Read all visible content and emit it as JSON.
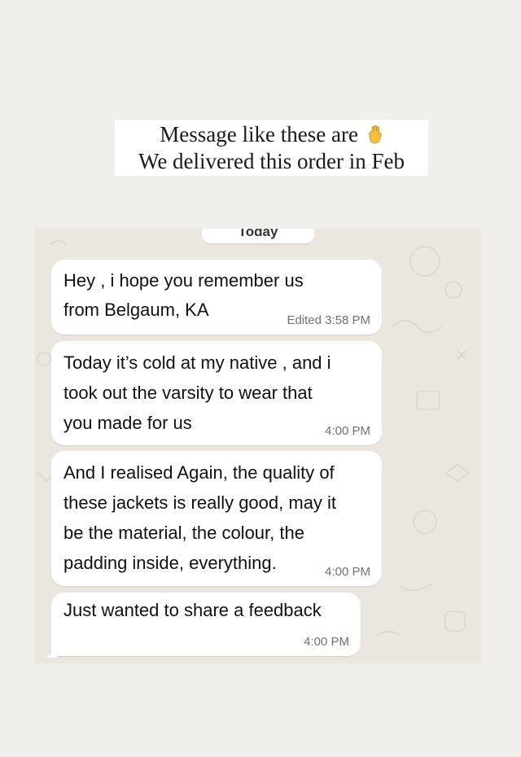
{
  "caption": {
    "line1": "Message like these are",
    "line2": "We delivered this order in Feb",
    "emoji_icon": "hand-emoji-icon"
  },
  "chat": {
    "date_divider": "Today",
    "messages": [
      {
        "text": "Hey      , i hope you remember us\nfrom Belgaum, KA",
        "meta": "Edited 3:58 PM"
      },
      {
        "text": "Today it’s cold at my native , and i\ntook out the varsity to wear that\nyou made for us",
        "meta": "4:00 PM"
      },
      {
        "text": "And I realised Again, the quality of\nthese jackets is really good, may it\nbe the material, the colour, the\npadding inside, everything.",
        "meta": "4:00 PM"
      },
      {
        "text": "Just wanted to share a feedback",
        "meta": "4:00 PM"
      }
    ]
  },
  "colors": {
    "page_background": "#f1efec",
    "chat_background": "#ebe6df",
    "bubble_background": "#ffffff",
    "timestamp_text": "#707070"
  }
}
